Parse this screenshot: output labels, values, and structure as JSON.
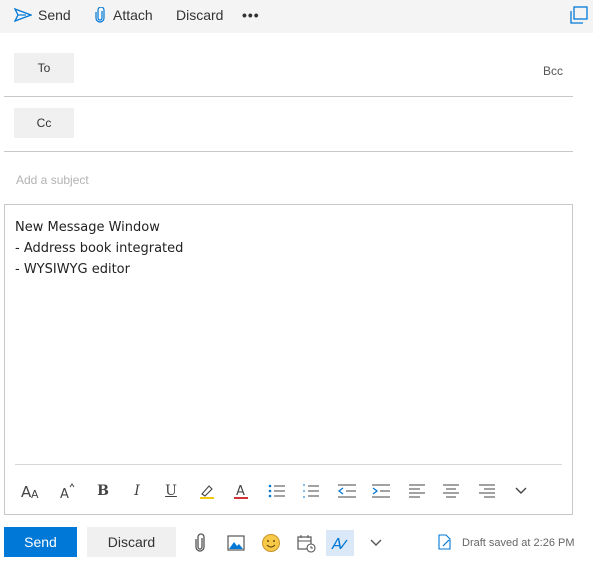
{
  "toolbar": {
    "send_label": "Send",
    "attach_label": "Attach",
    "discard_label": "Discard",
    "more_label": "•••",
    "icons": {
      "send": "send-icon",
      "attach": "paperclip-icon",
      "popout": "pop-out-icon"
    }
  },
  "recipients": {
    "to_label": "To",
    "cc_label": "Cc",
    "bcc_label": "Bcc",
    "to_value": "",
    "cc_value": ""
  },
  "subject": {
    "placeholder": "Add a subject",
    "value": ""
  },
  "body": {
    "lines": [
      "New Message Window",
      "- Address book integrated",
      "- WYSIWYG editor"
    ]
  },
  "format_toolbar": {
    "items": [
      {
        "name": "font-size-icon",
        "glyph": "A A"
      },
      {
        "name": "grow-font-icon",
        "glyph": "A"
      },
      {
        "name": "bold-icon",
        "glyph": "B"
      },
      {
        "name": "italic-icon",
        "glyph": "I"
      },
      {
        "name": "underline-icon",
        "glyph": "U"
      },
      {
        "name": "highlight-icon",
        "glyph": ""
      },
      {
        "name": "font-color-icon",
        "glyph": "A"
      },
      {
        "name": "bullets-icon",
        "glyph": ""
      },
      {
        "name": "numbering-icon",
        "glyph": ""
      },
      {
        "name": "decrease-indent-icon",
        "glyph": ""
      },
      {
        "name": "increase-indent-icon",
        "glyph": ""
      },
      {
        "name": "align-left-icon",
        "glyph": ""
      },
      {
        "name": "align-center-icon",
        "glyph": ""
      },
      {
        "name": "align-right-icon",
        "glyph": ""
      },
      {
        "name": "more-formatting-icon",
        "glyph": ""
      }
    ],
    "highlight_color": "#f2c811",
    "font_color": "#d13438"
  },
  "footer": {
    "send_label": "Send",
    "discard_label": "Discard",
    "draft_status": "Draft saved at 2:26 PM",
    "accent_color": "#0078d7"
  }
}
